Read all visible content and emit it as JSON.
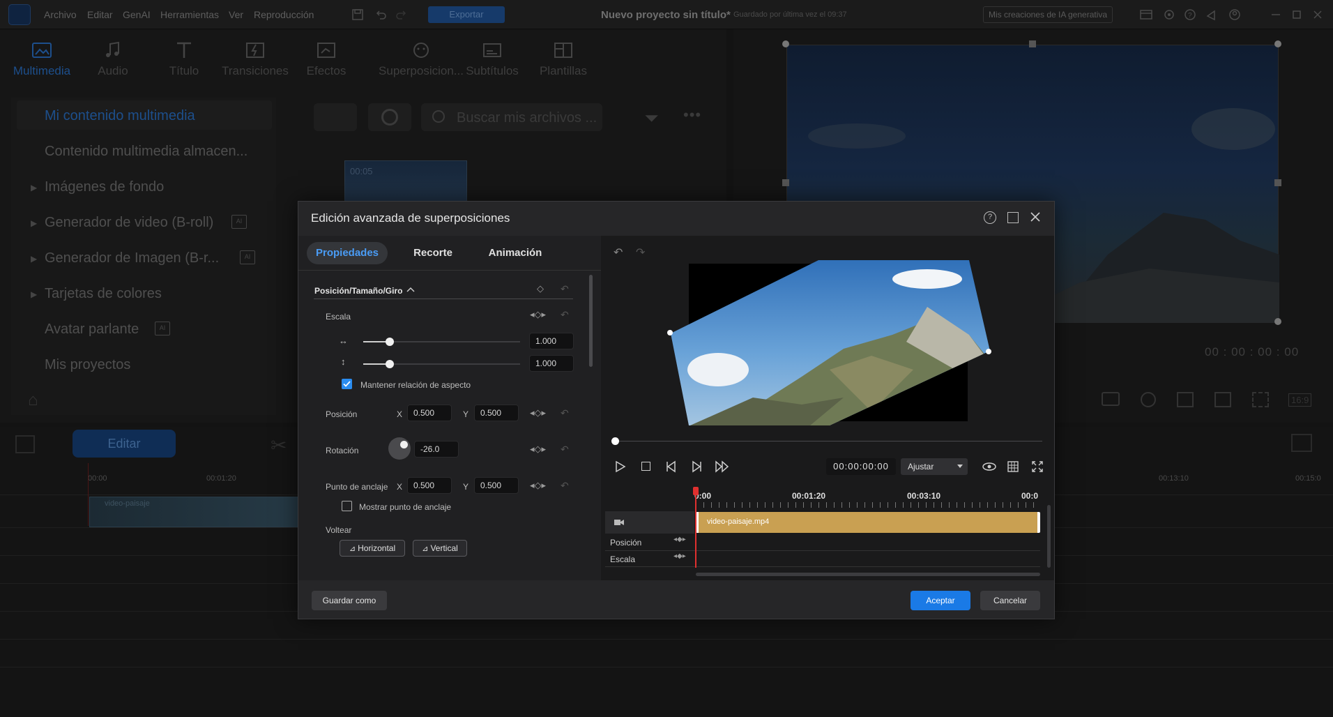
{
  "menu": {
    "items": [
      "Archivo",
      "Editar",
      "GenAI",
      "Herramientas",
      "Ver",
      "Reproducción"
    ]
  },
  "toolbar": {
    "export_label": "Exportar"
  },
  "project": {
    "title": "Nuevo proyecto sin título*",
    "saved": "Guardado por última vez el 09:37"
  },
  "header_right": {
    "ai_creations": "Mis creaciones de IA generativa"
  },
  "tabs": [
    {
      "label": "Multimedia"
    },
    {
      "label": "Audio"
    },
    {
      "label": "Título"
    },
    {
      "label": "Transiciones"
    },
    {
      "label": "Efectos"
    },
    {
      "label": "Superposicion..."
    },
    {
      "label": "Subtítulos"
    },
    {
      "label": "Plantillas"
    }
  ],
  "sidebar": {
    "items": [
      {
        "label": "Mi contenido multimedia"
      },
      {
        "label": "Contenido multimedia almacen..."
      },
      {
        "label": "Imágenes de fondo"
      },
      {
        "label": "Generador de video (B-roll)"
      },
      {
        "label": "Generador de Imagen (B-r..."
      },
      {
        "label": "Tarjetas de colores"
      },
      {
        "label": "Avatar parlante"
      },
      {
        "label": "Mis proyectos"
      }
    ]
  },
  "media": {
    "search_placeholder": "Buscar mis archivos ...",
    "thumb_duration": "00:05"
  },
  "preview": {
    "timecode": "00 : 00 : 00 : 00",
    "ratio": "16:9"
  },
  "timeline": {
    "edit_label": "Editar",
    "ruler": [
      "00:00",
      "00:01:20",
      "00:13:10",
      "00:15:0"
    ],
    "clip_label": "video-paisaje"
  },
  "dialog": {
    "title": "Edición avanzada de superposiciones",
    "tabs": [
      "Propiedades",
      "Recorte",
      "Animación"
    ],
    "section": "Posición/Tamaño/Giro",
    "scale": {
      "label": "Escala",
      "width": "1.000",
      "height": "1.000",
      "width_level": 0.17,
      "height_level": 0.17,
      "keep_aspect": "Mantener relación de aspecto"
    },
    "position": {
      "label": "Posición",
      "x_label": "X",
      "x": "0.500",
      "y_label": "Y",
      "y": "0.500"
    },
    "rotation": {
      "label": "Rotación",
      "value": "-26.0"
    },
    "anchor": {
      "label": "Punto de anclaje",
      "x_label": "X",
      "x": "0.500",
      "y_label": "Y",
      "y": "0.500",
      "show": "Mostrar punto de anclaje"
    },
    "flip": {
      "label": "Voltear",
      "horizontal": "Horizontal",
      "vertical": "Vertical"
    },
    "player": {
      "timecode": "00:00:00:00",
      "fit": "Ajustar"
    },
    "mini_timeline": {
      "ruler": [
        "0:00",
        "00:01:20",
        "00:03:10",
        "00:0"
      ],
      "clip": "video-paisaje.mp4",
      "tracks": [
        "Posición",
        "Escala"
      ]
    },
    "buttons": {
      "save_as": "Guardar como",
      "accept": "Aceptar",
      "cancel": "Cancelar"
    }
  },
  "colors": {
    "accent": "#1a7ae6",
    "clip": "#c9a052",
    "playhead": "#e0302f"
  }
}
